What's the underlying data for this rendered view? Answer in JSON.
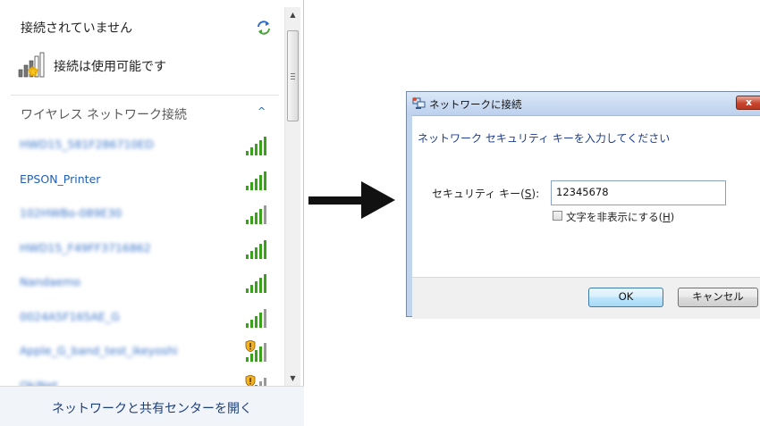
{
  "flyout": {
    "status_text": "接続されていません",
    "connection_available_text": "接続は使用可能です",
    "section_heading": "ワイヤレス ネットワーク接続",
    "section_chevron": "^",
    "networks": [
      {
        "ssid": "HWD15_581F286710ED",
        "blurred": true,
        "signal_bars": 5,
        "secured_warning": false
      },
      {
        "ssid": "EPSON_Printer",
        "blurred": false,
        "signal_bars": 5,
        "secured_warning": false
      },
      {
        "ssid": "102HWBo-089E30",
        "blurred": true,
        "signal_bars": 4,
        "secured_warning": false
      },
      {
        "ssid": "HWD15_F49FF3716862",
        "blurred": true,
        "signal_bars": 5,
        "secured_warning": false
      },
      {
        "ssid": "Nandaemo",
        "blurred": true,
        "signal_bars": 5,
        "secured_warning": false
      },
      {
        "ssid": "0024A5F165AE_G",
        "blurred": true,
        "signal_bars": 4,
        "secured_warning": false
      },
      {
        "ssid": "Apple_G_band_test_ikeyoshi",
        "blurred": true,
        "signal_bars": 4,
        "secured_warning": true
      },
      {
        "ssid": "OkiNet",
        "blurred": true,
        "signal_bars": 3,
        "secured_warning": true
      }
    ],
    "footer_link": "ネットワークと共有センターを開く",
    "icons": {
      "refresh": "refresh-icon",
      "connection": "signal-warning-icon",
      "scroll_up": "▲",
      "scroll_down": "▼"
    }
  },
  "dialog": {
    "title": "ネットワークに接続",
    "close_label": "x",
    "prompt": "ネットワーク セキュリティ キーを入力してください",
    "key_label_pre": "セキュリティ キー(",
    "key_label_mnemonic": "S",
    "key_label_post": "):",
    "key_value": "12345678",
    "hide_chars_pre": "文字を非表示にする(",
    "hide_chars_mnemonic": "H",
    "hide_chars_post": ")",
    "hide_chars_checked": false,
    "ok_label": "OK",
    "cancel_label": "キャンセル"
  },
  "colors": {
    "link_blue": "#1f5fb8",
    "signal_green": "#3aa11a",
    "arrow": "#111111",
    "dialog_frame": "#c2d5ef",
    "close_red": "#c7452d"
  }
}
